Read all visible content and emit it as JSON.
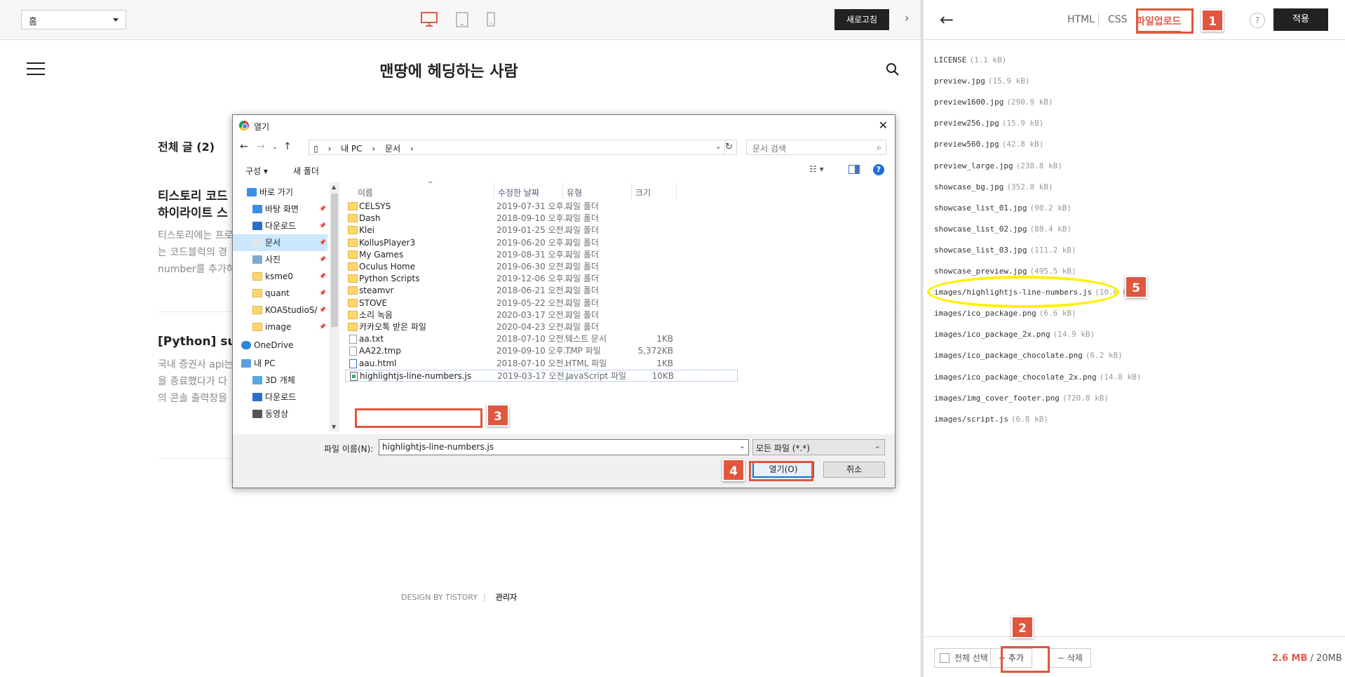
{
  "topbar": {
    "home_select": "홈",
    "refresh_label": "새로고침"
  },
  "blog": {
    "title": "맨땅에 헤딩하는 사람",
    "all_posts": "전체 글 (2)",
    "post1_title_line1": "티스토리 코드",
    "post1_title_line2": "하이라이트 스",
    "post1_text": [
      "티스토리에는 프로",
      "는 코드블럭의 경",
      "number를 추가하"
    ],
    "post2_title": "[Python] sub",
    "post2_text": [
      "국내 증권사 api는",
      "을 종료했다가 다",
      "의 콘솔 출력창을"
    ],
    "footer_design": "DESIGN BY TISTORY",
    "footer_admin": "관리자"
  },
  "dialog": {
    "title": "열기",
    "path": [
      "내 PC",
      "문서"
    ],
    "search_placeholder": "문서 검색",
    "organize": "구성 ▾",
    "new_folder": "새 폴더",
    "sidebar": [
      {
        "label": "바로 가기",
        "icon": "star-icon"
      },
      {
        "label": "바탕 화면",
        "icon": "desktop-icon"
      },
      {
        "label": "다운로드",
        "icon": "download-icon"
      },
      {
        "label": "문서",
        "icon": "document-icon"
      },
      {
        "label": "사진",
        "icon": "picture-icon"
      },
      {
        "label": "ksme0",
        "icon": "folder-icon"
      },
      {
        "label": "quant",
        "icon": "folder-icon"
      },
      {
        "label": "KOAStudioS/",
        "icon": "folder-icon"
      },
      {
        "label": "image",
        "icon": "folder-icon"
      },
      {
        "label": "OneDrive",
        "icon": "cloud-icon"
      },
      {
        "label": "내 PC",
        "icon": "pc-icon"
      },
      {
        "label": "3D 개체",
        "icon": "cube-icon"
      },
      {
        "label": "다운로드",
        "icon": "download-icon"
      },
      {
        "label": "동영상",
        "icon": "video-icon"
      }
    ],
    "columns": {
      "name": "이름",
      "date": "수정한 날짜",
      "type": "유형",
      "size": "크기"
    },
    "files": [
      {
        "name": "CELSYS",
        "date": "2019-07-31 오후...",
        "type": "파일 폴더",
        "size": ""
      },
      {
        "name": "Dash",
        "date": "2018-09-10 오후...",
        "type": "파일 폴더",
        "size": ""
      },
      {
        "name": "Klei",
        "date": "2019-01-25 오전...",
        "type": "파일 폴더",
        "size": ""
      },
      {
        "name": "KollusPlayer3",
        "date": "2019-06-20 오후...",
        "type": "파일 폴더",
        "size": ""
      },
      {
        "name": "My Games",
        "date": "2019-08-31 오후...",
        "type": "파일 폴더",
        "size": ""
      },
      {
        "name": "Oculus Home",
        "date": "2019-06-30 오전...",
        "type": "파일 폴더",
        "size": ""
      },
      {
        "name": "Python Scripts",
        "date": "2019-12-06 오후...",
        "type": "파일 폴더",
        "size": ""
      },
      {
        "name": "steamvr",
        "date": "2018-06-21 오전...",
        "type": "파일 폴더",
        "size": ""
      },
      {
        "name": "STOVE",
        "date": "2019-05-22 오전...",
        "type": "파일 폴더",
        "size": ""
      },
      {
        "name": "소리 녹음",
        "date": "2020-03-17 오전...",
        "type": "파일 폴더",
        "size": ""
      },
      {
        "name": "카카오톡 받은 파일",
        "date": "2020-04-23 오전...",
        "type": "파일 폴더",
        "size": ""
      },
      {
        "name": "aa.txt",
        "date": "2018-07-10 오전...",
        "type": "텍스트 문서",
        "size": "1KB"
      },
      {
        "name": "AA22.tmp",
        "date": "2019-09-10 오후...",
        "type": "TMP 파일",
        "size": "5,372KB"
      },
      {
        "name": "aau.html",
        "date": "2018-07-10 오전...",
        "type": "HTML 파일",
        "size": "1KB"
      },
      {
        "name": "highlightjs-line-numbers.js",
        "date": "2019-03-17 오전...",
        "type": "JavaScript 파일",
        "size": "10KB"
      }
    ],
    "filename_label": "파일 이름(N):",
    "filename_value": "highlightjs-line-numbers.js",
    "filetype_value": "모든 파일 (*.*)",
    "open_label": "열기(O)",
    "cancel_label": "취소"
  },
  "panel": {
    "tab_html": "HTML",
    "tab_css": "CSS",
    "tab_upload": "파일업로드",
    "help": "?",
    "apply": "적용",
    "files": [
      {
        "name": "LICENSE",
        "size": "(1.1 kB)"
      },
      {
        "name": "preview.jpg",
        "size": "(15.9 kB)"
      },
      {
        "name": "preview1600.jpg",
        "size": "(290.9 kB)"
      },
      {
        "name": "preview256.jpg",
        "size": "(15.9 kB)"
      },
      {
        "name": "preview560.jpg",
        "size": "(42.8 kB)"
      },
      {
        "name": "preview_large.jpg",
        "size": "(238.8 kB)"
      },
      {
        "name": "showcase_bg.jpg",
        "size": "(352.8 kB)"
      },
      {
        "name": "showcase_list_01.jpg",
        "size": "(90.2 kB)"
      },
      {
        "name": "showcase_list_02.jpg",
        "size": "(88.4 kB)"
      },
      {
        "name": "showcase_list_03.jpg",
        "size": "(111.2 kB)"
      },
      {
        "name": "showcase_preview.jpg",
        "size": "(495.5 kB)"
      },
      {
        "name": "images/highlightjs-line-numbers.js",
        "size": "(10.0 kB)"
      },
      {
        "name": "images/ico_package.png",
        "size": "(6.6 kB)"
      },
      {
        "name": "images/ico_package_2x.png",
        "size": "(14.9 kB)"
      },
      {
        "name": "images/ico_package_chocolate.png",
        "size": "(6.2 kB)"
      },
      {
        "name": "images/ico_package_chocolate_2x.png",
        "size": "(14.8 kB)"
      },
      {
        "name": "images/img_cover_footer.png",
        "size": "(720.8 kB)"
      },
      {
        "name": "images/script.js",
        "size": "(6.8 kB)"
      }
    ],
    "select_all": "전체 선택",
    "add": "+ 추가",
    "delete": "− 삭제",
    "quota_used": "2.6 MB",
    "quota_total": " / 20MB"
  },
  "annotations": [
    "1",
    "2",
    "3",
    "4",
    "5"
  ],
  "colors": {
    "accent": "#e2584a",
    "highlight": "#fff000",
    "annotation": "#e0563f"
  }
}
